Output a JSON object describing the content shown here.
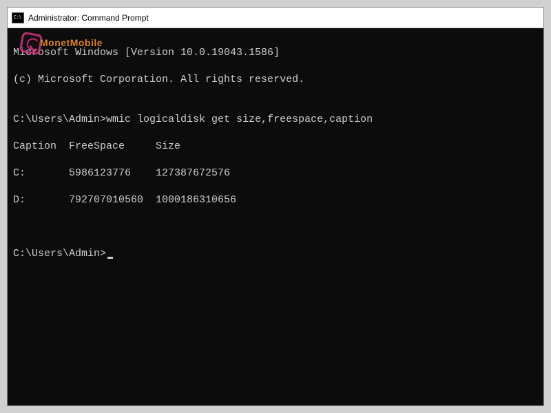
{
  "window": {
    "title": "Administrator: Command Prompt"
  },
  "terminal": {
    "line1": "Microsoft Windows [Version 10.0.19043.1586]",
    "line2": "(c) Microsoft Corporation. All rights reserved.",
    "blank1": "",
    "prompt1_path": "C:\\Users\\Admin>",
    "prompt1_cmd": "wmic logicaldisk get size,freespace,caption",
    "header_row": "Caption  FreeSpace     Size",
    "row_c": "C:       5986123776    127387672576",
    "row_d": "D:       792707010560  1000186310656",
    "blank2": "",
    "blank3": "",
    "prompt2_path": "C:\\Users\\Admin>"
  },
  "watermark": {
    "text": "MonetMobile"
  }
}
